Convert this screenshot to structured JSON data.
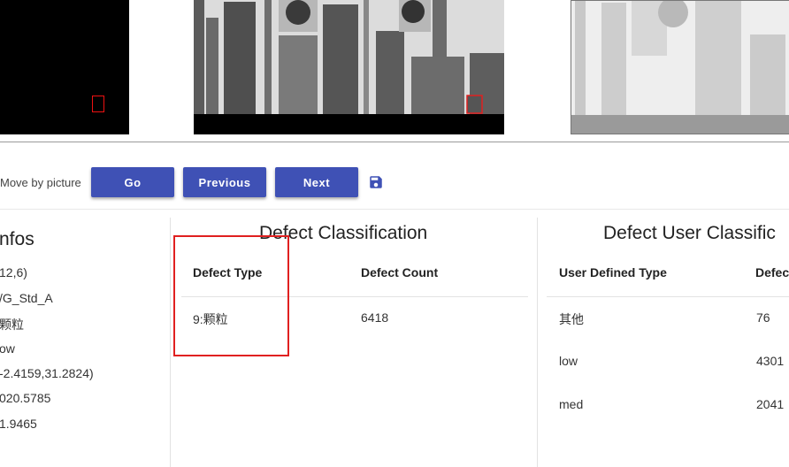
{
  "toolbar": {
    "move_label": "Move by picture",
    "go_label": "Go",
    "previous_label": "Previous",
    "next_label": "Next",
    "accent": "#3f51b5",
    "save_icon": "save-icon"
  },
  "infos": {
    "title": "nfos",
    "lines": [
      "12,6)",
      "/G_Std_A",
      "颗粒",
      "ow",
      "-2.4159,31.2824)",
      "020.5785",
      "1.9465"
    ]
  },
  "defect_classification": {
    "title": "Defect Classification",
    "headers": [
      "Defect Type",
      "Defect Count"
    ],
    "rows": [
      {
        "type": "9:颗粒",
        "count": "6418"
      }
    ]
  },
  "defect_user_classification": {
    "title": "Defect User Classific",
    "headers": [
      "User Defined Type",
      "Defec"
    ],
    "rows": [
      {
        "type": "其他",
        "count": "76"
      },
      {
        "type": "low",
        "count": "4301"
      },
      {
        "type": "med",
        "count": "2041"
      }
    ]
  },
  "highlight_color": "#e02020"
}
